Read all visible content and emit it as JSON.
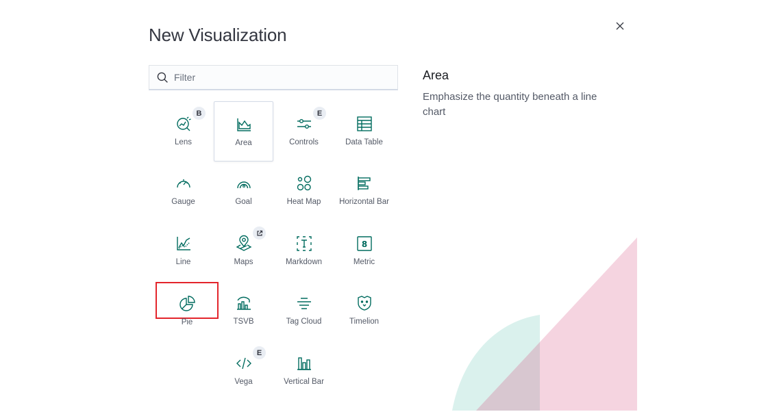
{
  "modal": {
    "title": "New Visualization",
    "search_placeholder": "Filter"
  },
  "types": [
    {
      "label": "Lens",
      "icon": "lens-icon",
      "badge": "B"
    },
    {
      "label": "Area",
      "icon": "area-chart-icon",
      "selected": true
    },
    {
      "label": "Controls",
      "icon": "controls-icon",
      "badge": "E"
    },
    {
      "label": "Data Table",
      "icon": "data-table-icon"
    },
    {
      "label": "Gauge",
      "icon": "gauge-icon"
    },
    {
      "label": "Goal",
      "icon": "goal-icon"
    },
    {
      "label": "Heat Map",
      "icon": "heat-map-icon"
    },
    {
      "label": "Horizontal Bar",
      "icon": "horizontal-bar-icon"
    },
    {
      "label": "Line",
      "icon": "line-chart-icon"
    },
    {
      "label": "Maps",
      "icon": "maps-icon",
      "external_link": true
    },
    {
      "label": "Markdown",
      "icon": "markdown-icon"
    },
    {
      "label": "Metric",
      "icon": "metric-icon"
    },
    {
      "label": "Pie",
      "icon": "pie-chart-icon",
      "highlighted": true
    },
    {
      "label": "TSVB",
      "icon": "tsvb-icon"
    },
    {
      "label": "Tag Cloud",
      "icon": "tag-cloud-icon"
    },
    {
      "label": "Timelion",
      "icon": "timelion-icon"
    },
    {
      "label": "Vega",
      "icon": "vega-icon",
      "badge": "E"
    },
    {
      "label": "Vertical Bar",
      "icon": "vertical-bar-icon"
    }
  ],
  "description": {
    "title": "Area",
    "text": "Emphasize the quantity beneath a line chart"
  },
  "colors": {
    "icon": "#006b5e",
    "highlight": "#e3242b",
    "illustration_teal": "#d4efea",
    "illustration_pink": "#f2c6d5"
  }
}
